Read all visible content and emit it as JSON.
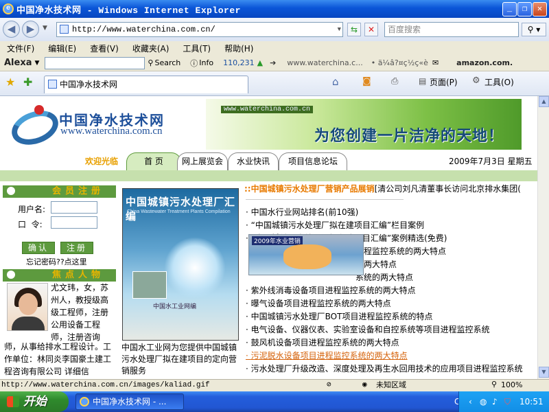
{
  "window": {
    "title": "中国净水技术网 - Windows Internet Explorer",
    "minimize": "_",
    "maximize": "❐",
    "close": "✕"
  },
  "address": {
    "url": "http://www.waterchina.com.cn/",
    "search_placeholder": "百度搜索"
  },
  "menu": [
    "文件(F)",
    "编辑(E)",
    "查看(V)",
    "收藏夹(A)",
    "工具(T)",
    "帮助(H)"
  ],
  "alexa": {
    "logo": "Alexa",
    "search_label": "Search",
    "info_label": "Info",
    "rank": "110,231",
    "site": "www.waterchina.c...",
    "amazon": "amazon.com."
  },
  "tab": {
    "title": "中国净水技术网",
    "page_label": "页面(P)",
    "tools_label": "工具(O)"
  },
  "site": {
    "logo_cn": "中国净水技术网",
    "logo_en": "www.waterchina.com.cn",
    "banner_url": "www.waterchina.com.cn",
    "slogan": "为您创建一片洁净的天地！",
    "welcome": "欢迎光临",
    "nav": [
      "首 页",
      "网上展览会",
      "水业快讯",
      "项目信息论坛"
    ],
    "date": "2009年7月3日  星期五"
  },
  "left": {
    "member_title": "会员注册",
    "username_label": "用户名:",
    "password_label": "口  令:",
    "confirm_btn": "确认",
    "register_btn": "注册",
    "forgot": "忘记密码??点这里",
    "focus_title": "焦点人物",
    "person_text": "尤文玮，女，苏州人，教授级高级工程师，注册公用设备工程师，注册咨询",
    "person_text2": "师，从事给排水工程设计。工作单位：林同炎李国豪土建工程咨询有限公司  详细信"
  },
  "middle": {
    "book_title": "中国城镇污水处理厂汇编",
    "book_subtitle": "China Wastewater Treatment Plants Compilation",
    "book_footer": "中国水工业网编",
    "caption": "中国水工业网为您提供中国城镇污水处理厂拟在建项目的定向营销服务"
  },
  "right": {
    "headline_marker": "::",
    "headline": "中国城镇污水处理厂营销产品展销",
    "headline_rest": "[清公司刘凡清董事长访问北京排水集团(",
    "popup_label": "2009年水业营销",
    "news": [
      "中国水行业网站排名(前10强)",
      "“中国城镇污水处理厂拟在建项目汇编”栏目案例",
      "“中国城镇污水处理厂拟在建项目汇编”案例精选(免费)",
      "进程监控系统的两大特点",
      "的两大特点",
      "系统的两大特点",
      "紫外线消毒设备项目进程监控系统的两大特点",
      "曝气设备项目进程监控系统的两大特点",
      "中国城镇污水处理厂BOT项目进程监控系统的特点",
      "电气设备、仪器仪表、实验室设备和自控系统等项目进程监控系统",
      "鼓风机设备项目进程监控系统的两大特点",
      "污泥脱水设备项目进程监控系统的两大特点",
      "污水处理厂升级改造、深度处理及再生水回用技术的应用项目进程监控系统"
    ]
  },
  "status": {
    "url": "http://www.waterchina.com.cn/images/kaliad.gif",
    "zone": "未知区域",
    "zoom": "100%"
  },
  "taskbar": {
    "start": "开始",
    "item": "中国净水技术网 - ...",
    "lang": "CH",
    "time": "10:51"
  },
  "colors": {
    "titlebar": "#0a55d8",
    "site_green": "#5d9a3e",
    "accent_orange": "#e87a00",
    "taskbar": "#245edc"
  }
}
